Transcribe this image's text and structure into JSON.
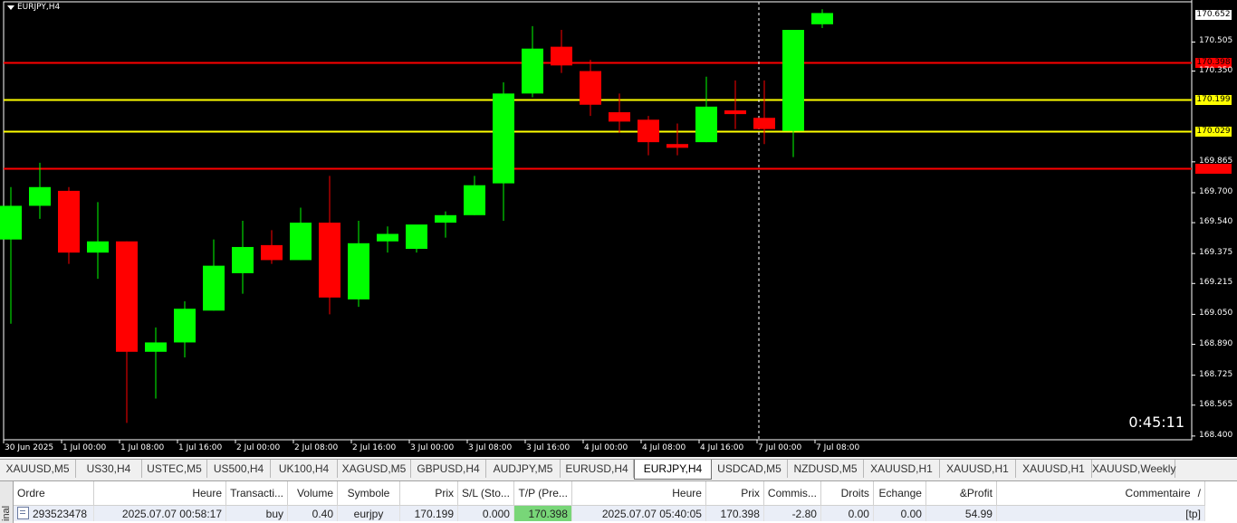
{
  "chart": {
    "symbol": "EURJPY,H4",
    "countdown": "0:45:11",
    "colors": {
      "background": "#000000",
      "bull": "#00ff00",
      "bear": "#ff0000",
      "resistance": "#ff0000",
      "mid": "#ffff00"
    },
    "price_ticks": [
      "170.505",
      "170.350",
      "169.865",
      "169.700",
      "169.540",
      "169.375",
      "169.215",
      "169.050",
      "168.890",
      "168.725",
      "168.565",
      "168.400"
    ],
    "time_labels": [
      "30 Jun 2025",
      "1 Jul 00:00",
      "1 Jul 08:00",
      "1 Jul 16:00",
      "2 Jul 00:00",
      "2 Jul 08:00",
      "2 Jul 16:00",
      "3 Jul 00:00",
      "3 Jul 08:00",
      "3 Jul 16:00",
      "4 Jul 00:00",
      "4 Jul 08:00",
      "4 Jul 16:00",
      "7 Jul 00:00",
      "7 Jul 08:00"
    ],
    "price_tags": [
      {
        "label": "170.652",
        "price": 170.652,
        "bg": "#ffffff",
        "fg": "#000000"
      },
      {
        "label": "170.398",
        "price": 170.398,
        "bg": "#ff0000",
        "fg": "#000000"
      },
      {
        "label": "170.199",
        "price": 170.199,
        "bg": "#ffff00",
        "fg": "#000000"
      },
      {
        "label": "170.029",
        "price": 170.029,
        "bg": "#ffff00",
        "fg": "#000000"
      },
      {
        "label": "169.831",
        "price": 169.831,
        "bg": "#ff0000",
        "fg": "#ff0000"
      }
    ],
    "horizontal_lines": [
      {
        "price": 170.398,
        "color": "#ff0000"
      },
      {
        "price": 170.199,
        "color": "#ffff00"
      },
      {
        "price": 170.029,
        "color": "#ffff00"
      },
      {
        "price": 169.831,
        "color": "#ff0000"
      }
    ]
  },
  "chart_data": {
    "type": "candlestick",
    "ylim": [
      168.4,
      170.7
    ],
    "candles": [
      {
        "o": 169.45,
        "h": 169.73,
        "l": 169.0,
        "c": 169.63
      },
      {
        "o": 169.63,
        "h": 169.86,
        "l": 169.56,
        "c": 169.73
      },
      {
        "o": 169.71,
        "h": 169.73,
        "l": 169.32,
        "c": 169.38
      },
      {
        "o": 169.38,
        "h": 169.65,
        "l": 169.24,
        "c": 169.44
      },
      {
        "o": 169.44,
        "h": 169.44,
        "l": 168.47,
        "c": 168.85
      },
      {
        "o": 168.85,
        "h": 168.98,
        "l": 168.6,
        "c": 168.9
      },
      {
        "o": 168.9,
        "h": 169.12,
        "l": 168.82,
        "c": 169.08
      },
      {
        "o": 169.07,
        "h": 169.45,
        "l": 169.07,
        "c": 169.31
      },
      {
        "o": 169.27,
        "h": 169.55,
        "l": 169.16,
        "c": 169.41
      },
      {
        "o": 169.42,
        "h": 169.5,
        "l": 169.32,
        "c": 169.34
      },
      {
        "o": 169.34,
        "h": 169.62,
        "l": 169.34,
        "c": 169.54
      },
      {
        "o": 169.54,
        "h": 169.79,
        "l": 169.05,
        "c": 169.14
      },
      {
        "o": 169.13,
        "h": 169.55,
        "l": 169.09,
        "c": 169.43
      },
      {
        "o": 169.44,
        "h": 169.52,
        "l": 169.38,
        "c": 169.48
      },
      {
        "o": 169.4,
        "h": 169.52,
        "l": 169.38,
        "c": 169.53
      },
      {
        "o": 169.54,
        "h": 169.6,
        "l": 169.46,
        "c": 169.58
      },
      {
        "o": 169.58,
        "h": 169.79,
        "l": 169.58,
        "c": 169.74
      },
      {
        "o": 169.75,
        "h": 170.29,
        "l": 169.55,
        "c": 170.23
      },
      {
        "o": 170.23,
        "h": 170.59,
        "l": 170.21,
        "c": 170.47
      },
      {
        "o": 170.48,
        "h": 170.57,
        "l": 170.34,
        "c": 170.38
      },
      {
        "o": 170.35,
        "h": 170.41,
        "l": 170.11,
        "c": 170.17
      },
      {
        "o": 170.13,
        "h": 170.23,
        "l": 170.02,
        "c": 170.08
      },
      {
        "o": 170.09,
        "h": 170.11,
        "l": 169.9,
        "c": 169.97
      },
      {
        "o": 169.96,
        "h": 170.07,
        "l": 169.9,
        "c": 169.94
      },
      {
        "o": 169.97,
        "h": 170.32,
        "l": 169.97,
        "c": 170.16
      },
      {
        "o": 170.14,
        "h": 170.3,
        "l": 170.04,
        "c": 170.12
      },
      {
        "o": 170.1,
        "h": 170.3,
        "l": 169.96,
        "c": 170.04
      },
      {
        "o": 170.03,
        "h": 170.57,
        "l": 169.89,
        "c": 170.57
      },
      {
        "o": 170.6,
        "h": 170.68,
        "l": 170.58,
        "c": 170.66
      }
    ]
  },
  "tabs": [
    "XAUUSD,M5",
    "US30,H4",
    "USTEC,M5",
    "US500,H4",
    "UK100,H4",
    "XAGUSD,M5",
    "GBPUSD,H4",
    "AUDJPY,M5",
    "EURUSD,H4",
    "EURJPY,H4",
    "USDCAD,M5",
    "NZDUSD,M5",
    "XAUUSD,H1",
    "XAUUSD,H1",
    "XAUUSD,H1",
    "XAUUSD,Weekly"
  ],
  "active_tab": 9,
  "terminal": {
    "side_label": "inal",
    "headers": [
      "Ordre",
      "Heure",
      "Transacti...",
      "Volume",
      "Symbole",
      "Prix",
      "S/L (Sto...",
      "T/P (Pre...",
      "Heure",
      "Prix",
      "Commis...",
      "Droits",
      "Echange",
      "&Profit",
      "Commentaire"
    ],
    "row": [
      "293523478",
      "2025.07.07 00:58:17",
      "buy",
      "0.40",
      "eurjpy",
      "170.199",
      "0.000",
      "170.398",
      "2025.07.07 05:40:05",
      "170.398",
      "-2.80",
      "0.00",
      "0.00",
      "54.99",
      "[tp]"
    ],
    "sort_icon": "/"
  }
}
